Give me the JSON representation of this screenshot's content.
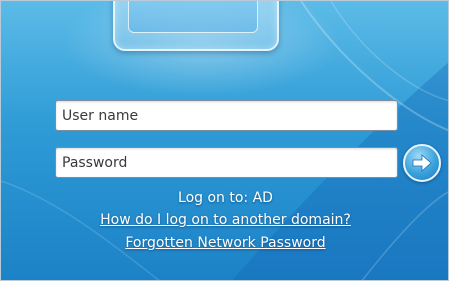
{
  "login": {
    "username_placeholder": "User name",
    "password_placeholder": "Password",
    "logon_to": "Log on to: AD",
    "domain_help_link": "How do I log on to another domain?",
    "forgotten_password_link": "Forgotten Network Password"
  },
  "icons": {
    "submit": "right-arrow-icon",
    "user_tile": "user-picture-frame"
  },
  "colors": {
    "background_top": "#5cbbe7",
    "background_bottom": "#1c82c7",
    "text": "#ffffff",
    "button": "#3aa2dc"
  }
}
